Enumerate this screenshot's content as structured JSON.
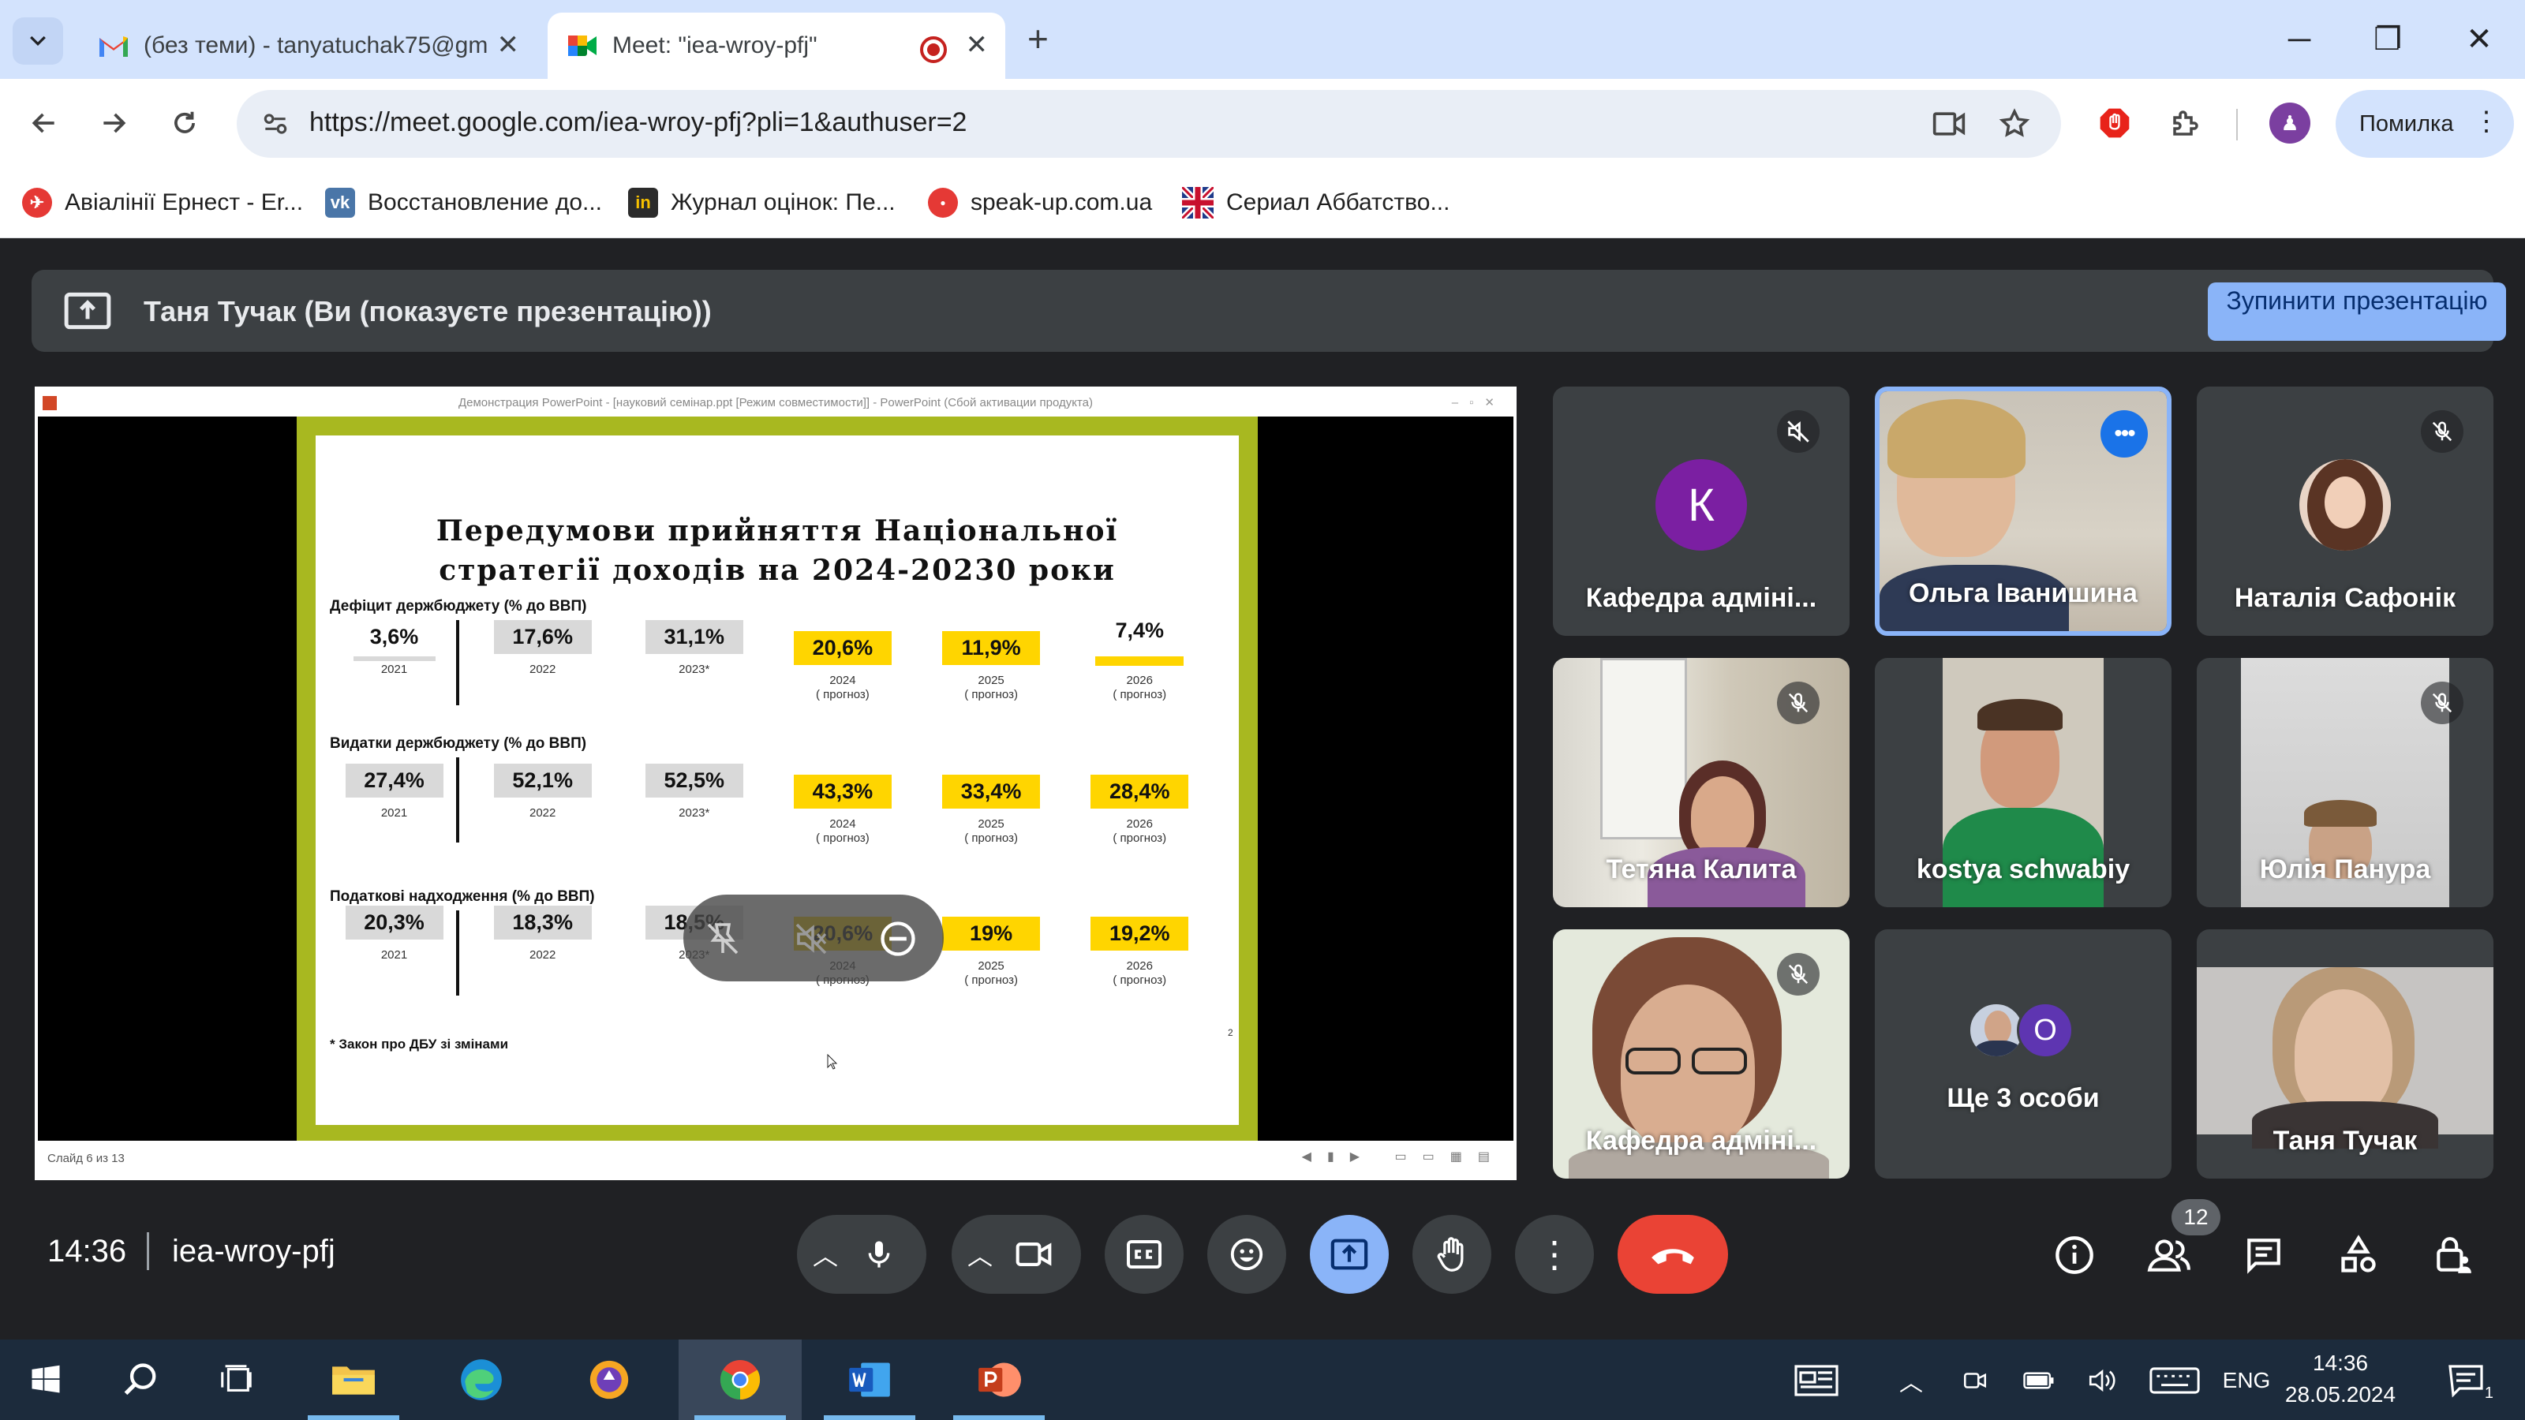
{
  "browser": {
    "tabs": [
      {
        "title": "(без теми) - tanyatuchak75@gm",
        "icon": "gmail-icon"
      },
      {
        "title": "Meet: \"iea-wroy-pfj\"",
        "icon": "meet-icon",
        "active": true
      }
    ],
    "url": "https://meet.google.com/iea-wroy-pfj?pli=1&authuser=2",
    "profile_label": "Помилка",
    "bookmarks": [
      {
        "label": "Авіалінії Ернест - Er...",
        "icon": "airline-icon",
        "color": "#e53935"
      },
      {
        "label": "Восстановление до...",
        "icon": "vk-icon",
        "color": "#4a76a8"
      },
      {
        "label": "Журнал оцінок: Пе...",
        "icon": "journal-icon",
        "color": "#2b2b2b"
      },
      {
        "label": "speak-up.com.ua",
        "icon": "speakup-icon",
        "color": "#e53935"
      },
      {
        "label": "Сериал Аббатство...",
        "icon": "uk-flag-icon",
        "color": "#1e3a8a"
      }
    ]
  },
  "meet": {
    "banner_text": "Таня Тучак (Ви (показуєте презентацію))",
    "stop_button": "Зупинити презентацію",
    "clock": "14:36",
    "meeting_code": "iea-wroy-pfj",
    "people_count": "12",
    "colors": {
      "accent": "#8ab4f8",
      "end_call": "#ea4335",
      "bg": "#202124",
      "tile": "#3c4043"
    }
  },
  "presentation": {
    "window_title": "Демонстрация PowerPoint - [науковий семінар.ppt [Режим совместимости]] - PowerPoint (Сбой активации продукта)",
    "slide_status": "Слайд 6 из 13",
    "slide_title_line1": "Передумови прийняття Національної",
    "slide_title_line2": "стратегії доходів на 2024-20230 роки",
    "sections": [
      {
        "title": "Дефіцит держбюджету (% до ВВП)",
        "items": [
          {
            "value": "3,6%",
            "year": "2021",
            "note": ""
          },
          {
            "value": "17,6%",
            "year": "2022",
            "note": ""
          },
          {
            "value": "31,1%",
            "year": "2023*",
            "note": ""
          },
          {
            "value": "20,6%",
            "year": "2024",
            "note": "( прогноз)"
          },
          {
            "value": "11,9%",
            "year": "2025",
            "note": "( прогноз)"
          },
          {
            "value": "7,4%",
            "year": "2026",
            "note": "( прогноз)"
          }
        ]
      },
      {
        "title": "Видатки держбюджету (% до ВВП)",
        "items": [
          {
            "value": "27,4%",
            "year": "2021",
            "note": ""
          },
          {
            "value": "52,1%",
            "year": "2022",
            "note": ""
          },
          {
            "value": "52,5%",
            "year": "2023*",
            "note": ""
          },
          {
            "value": "43,3%",
            "year": "2024",
            "note": "( прогноз)"
          },
          {
            "value": "33,4%",
            "year": "2025",
            "note": "( прогноз)"
          },
          {
            "value": "28,4%",
            "year": "2026",
            "note": "( прогноз)"
          }
        ]
      },
      {
        "title": "Податкові надходження (% до ВВП)",
        "items": [
          {
            "value": "20,3%",
            "year": "2021",
            "note": ""
          },
          {
            "value": "18,3%",
            "year": "2022",
            "note": ""
          },
          {
            "value": "18,5%",
            "year": "2023*",
            "note": ""
          },
          {
            "value": "20,6%",
            "year": "2024",
            "note": "( прогноз)"
          },
          {
            "value": "19%",
            "year": "2025",
            "note": "( прогноз)"
          },
          {
            "value": "19,2%",
            "year": "2026",
            "note": "( прогноз)"
          }
        ]
      }
    ],
    "footnote": "* Закон про ДБУ зі змінами",
    "page_mark": "2"
  },
  "participants": [
    {
      "name": "Кафедра адміні...",
      "avatar_letter": "К",
      "muted": true
    },
    {
      "name": "Ольга Іванишина",
      "speaking": true
    },
    {
      "name": "Наталія Сафонік",
      "muted": true
    },
    {
      "name": "Тетяна Калита",
      "muted": true
    },
    {
      "name": "kostya schwabiy"
    },
    {
      "name": "Юлія Панура",
      "muted": true
    },
    {
      "name": "Кафедра адміні...",
      "muted": true
    },
    {
      "name": "Ще 3 особи",
      "avatar_letter": "О"
    },
    {
      "name": "Таня Тучак"
    }
  ],
  "taskbar": {
    "language": "ENG",
    "time": "14:36",
    "date": "28.05.2024",
    "notification_count": "1"
  }
}
